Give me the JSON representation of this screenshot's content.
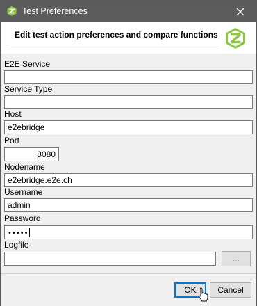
{
  "window": {
    "title": "Test Preferences"
  },
  "header": {
    "text": "Edit test action preferences and compare functions"
  },
  "fields": {
    "e2e_service": {
      "label": "E2E Service",
      "value": ""
    },
    "service_type": {
      "label": "Service Type",
      "value": ""
    },
    "host": {
      "label": "Host",
      "value": "e2ebridge"
    },
    "port": {
      "label": "Port",
      "value": "8080"
    },
    "nodename": {
      "label": "Nodename",
      "value": "e2ebridge.e2e.ch"
    },
    "username": {
      "label": "Username",
      "value": "admin"
    },
    "password": {
      "label": "Password",
      "value": "•••••"
    },
    "logfile": {
      "label": "Logfile",
      "value": ""
    }
  },
  "buttons": {
    "browse": "...",
    "ok": "OK",
    "cancel": "Cancel"
  },
  "colors": {
    "titlebar": "#5c5c5c",
    "logo_green": "#8dc63f",
    "default_button_border": "#0078d7"
  }
}
